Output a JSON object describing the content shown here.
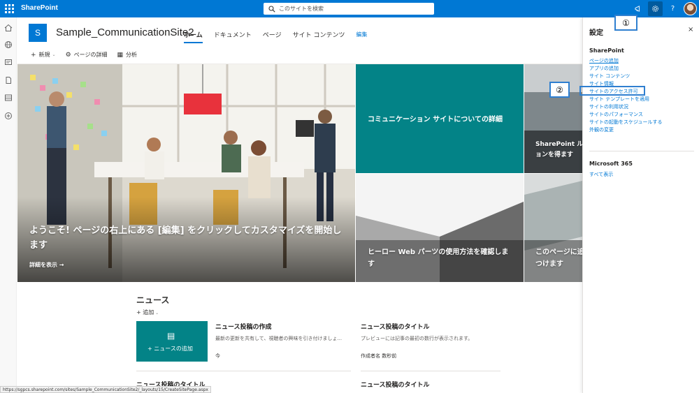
{
  "suitebar": {
    "brand": "SharePoint",
    "search_placeholder": "このサイトを検索",
    "help": "?"
  },
  "site": {
    "logo_letter": "S",
    "title": "Sample_CommunicationSite2",
    "nav": [
      {
        "label": "ホーム",
        "active": true
      },
      {
        "label": "ドキュメント",
        "active": false
      },
      {
        "label": "ページ",
        "active": false
      },
      {
        "label": "サイト コンテンツ",
        "active": false
      }
    ],
    "edit_label": "編集"
  },
  "commands": {
    "new": "新規",
    "page_details": "ページの詳細",
    "analytics": "分析"
  },
  "hero": {
    "main_title": "ようこそ! ページの右上にある [編集] をクリックしてカスタマイズを開始します",
    "main_link": "詳細を表示",
    "teal_title": "コミュニケーション サイトについての詳細",
    "right_top_title": "SharePoint ル ョンを得ます",
    "bottom_mid_title": "ヒーロー Web パーツの使用方法を確認します",
    "bottom_right_title": "このページに追 つけます"
  },
  "news": {
    "title": "ニュース",
    "add": "追加",
    "card_label": "ニュースの追加",
    "items": [
      {
        "title": "ニュース投稿の作成",
        "desc": "最新の更新を共有して、視聴者の興味を引き付けましょ...",
        "meta": "今"
      },
      {
        "title": "ニュース投稿のタイトル",
        "desc": "プレビューには記事の最初の数行が表示されます。",
        "meta": "作成者名 数秒前"
      },
      {
        "title": "ニュース投稿のタイトル",
        "desc": "",
        "meta": ""
      },
      {
        "title": "ニュース投稿のタイトル",
        "desc": "",
        "meta": ""
      }
    ]
  },
  "status_url": "https://sgpcs.sharepoint.com/sites/Sample_CommunicationSite2/_layouts/15/CreateSitePage.aspx",
  "panel": {
    "title": "設定",
    "close": "×",
    "sharepoint_header": "SharePoint",
    "links": [
      "ページの追加",
      "アプリの追加",
      "サイト コンテンツ",
      "サイト情報",
      "サイトのアクセス許可",
      "サイト テンプレートを適用",
      "サイトの利用状況",
      "サイトのパフォーマンス",
      "サイトの起動をスケジュールする",
      "外観の変更"
    ],
    "m365_header": "Microsoft 365",
    "show_all": "すべて表示"
  },
  "callouts": {
    "one": "①",
    "two": "②"
  },
  "colors": {
    "brand": "#0078d4",
    "teal": "#038387",
    "callout": "#2f7fd0"
  }
}
